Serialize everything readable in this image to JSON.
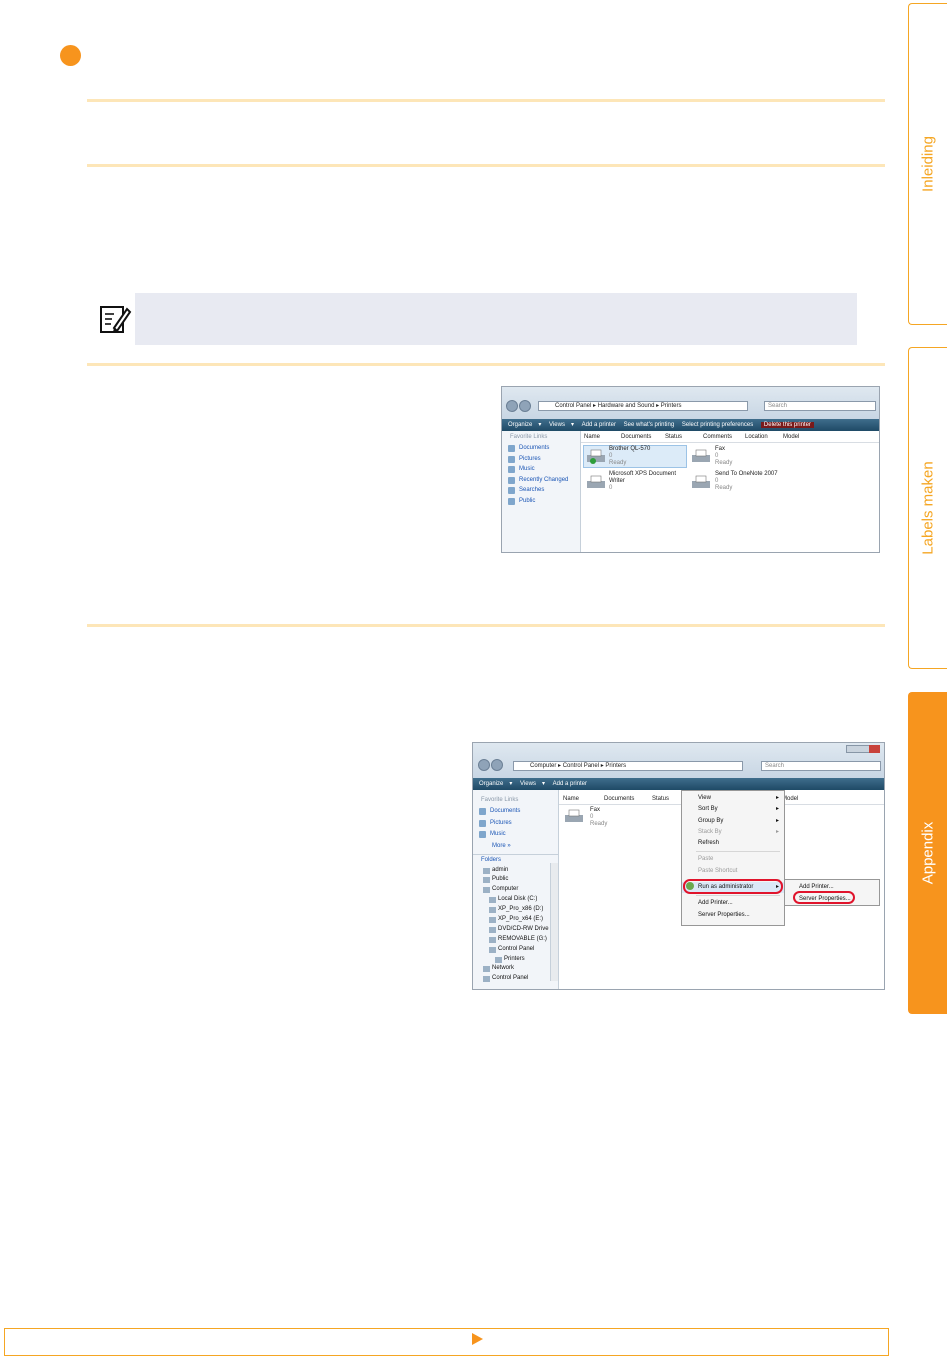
{
  "tabs": [
    {
      "label": "Inleiding",
      "active": false
    },
    {
      "label": "Labels maken",
      "active": false
    },
    {
      "label": "Appendix",
      "active": true
    }
  ],
  "colors": {
    "accent": "#f7941d",
    "rule": "#fde6b8",
    "note_bg": "#e8eaf2"
  },
  "screenshot1": {
    "breadcrumb": [
      "Control Panel",
      "Hardware and Sound",
      "Printers"
    ],
    "search_placeholder": "Search",
    "toolbar": [
      "Organize",
      "Views",
      "Add a printer",
      "See what's printing",
      "Select printing preferences",
      "Delete this printer"
    ],
    "favorite_links_header": "Favorite Links",
    "favorite_links": [
      "Documents",
      "Pictures",
      "Music",
      "Recently Changed",
      "Searches",
      "Public"
    ],
    "columns": [
      "Name",
      "Documents",
      "Status",
      "Comments",
      "Location",
      "Model"
    ],
    "printers": [
      {
        "name": "Brother QL-570",
        "docs": "0",
        "status": "Ready"
      },
      {
        "name": "Fax",
        "docs": "0",
        "status": "Ready"
      },
      {
        "name": "Microsoft XPS Document Writer",
        "docs": "0",
        "status": ""
      },
      {
        "name": "Send To OneNote 2007",
        "docs": "0",
        "status": "Ready"
      }
    ]
  },
  "screenshot2": {
    "breadcrumb": [
      "Computer",
      "Control Panel",
      "Printers"
    ],
    "search_placeholder": "Search",
    "toolbar": [
      "Organize",
      "Views",
      "Add a printer"
    ],
    "favorite_links_header": "Favorite Links",
    "favorite_links": [
      "Documents",
      "Pictures",
      "Music"
    ],
    "more_label": "More »",
    "folders_header": "Folders",
    "folders": [
      "admin",
      "Public",
      "Computer",
      "Local Disk (C:)",
      "XP_Pro_x86 (D:)",
      "XP_Pro_x64 (E:)",
      "DVD/CD-RW Drive",
      "REMOVABLE (G:)",
      "Control Panel",
      "Printers",
      "Network",
      "Control Panel"
    ],
    "columns": [
      "Name",
      "Documents",
      "Status",
      "Model"
    ],
    "printers": [
      {
        "name": "Fax",
        "docs": "0",
        "status": "Ready"
      }
    ],
    "context_menu": [
      "View",
      "Sort By",
      "Group By",
      "Stack By",
      "Refresh",
      "Paste",
      "Paste Shortcut",
      "Run as administrator",
      "Add Printer...",
      "Server Properties..."
    ],
    "submenu": [
      "Add Printer...",
      "Server Properties..."
    ]
  }
}
